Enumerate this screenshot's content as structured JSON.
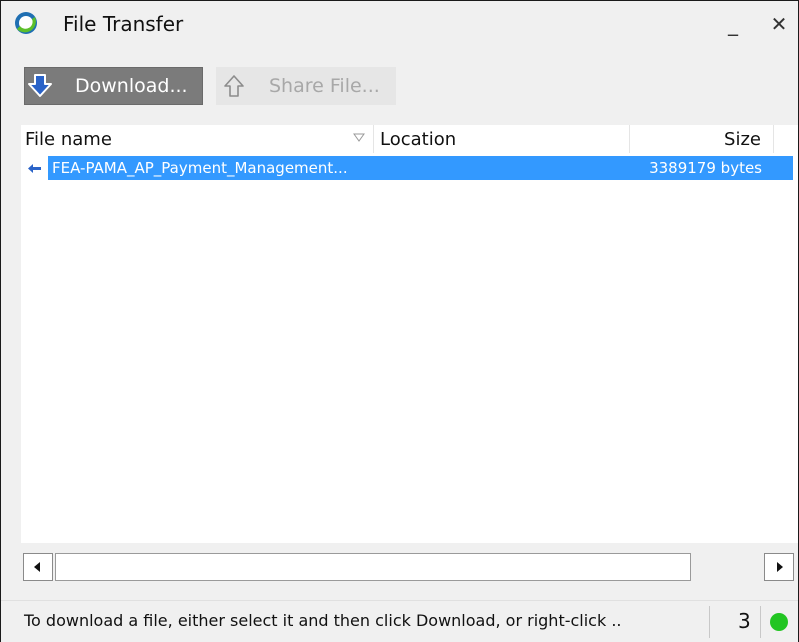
{
  "window": {
    "title": "File Transfer",
    "minimize_glyph": "_",
    "close_glyph": "✕"
  },
  "toolbar": {
    "download_label": "Download...",
    "share_label": "Share File..."
  },
  "file_list": {
    "columns": [
      "File name",
      "Location",
      "Size"
    ],
    "rows": [
      {
        "name": "FEA-PAMA_AP_Payment_Management...",
        "location": "",
        "size": "3389179 bytes"
      }
    ]
  },
  "statusbar": {
    "message": "To download a file, either select it and then click Download, or right-click ..",
    "count": "3"
  },
  "colors": {
    "selection": "#3399ff",
    "status_ok": "#22c522",
    "download_button": "#7b7b7b"
  }
}
